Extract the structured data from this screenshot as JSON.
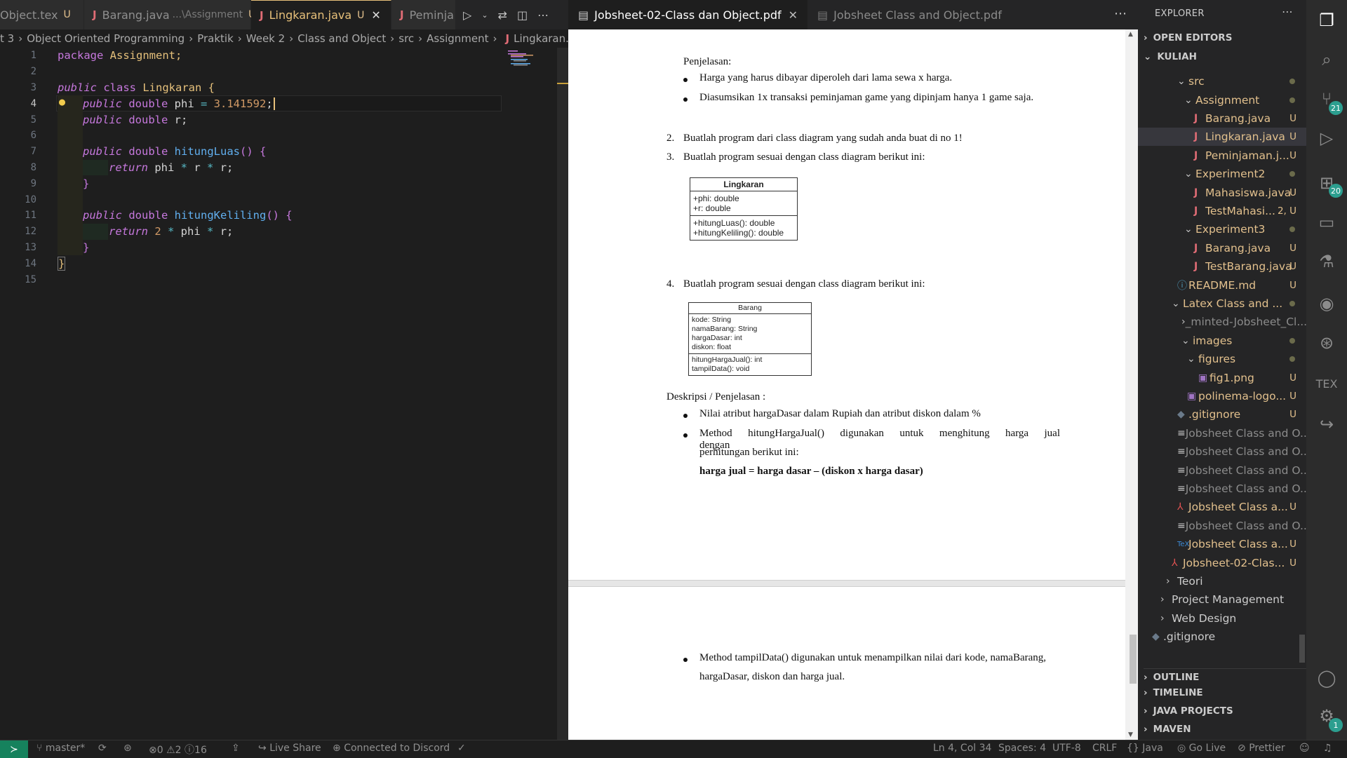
{
  "editor": {
    "tabs": [
      {
        "label": "Object.tex",
        "status": "U"
      },
      {
        "label": "Barang.java",
        "desc": "...\\Assignment",
        "status": "U"
      },
      {
        "label": "Lingkaran.java",
        "status": "U"
      },
      {
        "label": "Peminja"
      }
    ],
    "breadcrumb": [
      "t 3",
      "Object Oriented Programming",
      "Praktik",
      "Week 2",
      "Class and Object",
      "src",
      "Assignment",
      "Lingkaran.java"
    ],
    "line_numbers": [
      "1",
      "2",
      "3",
      "4",
      "5",
      "6",
      "7",
      "8",
      "9",
      "10",
      "11",
      "12",
      "13",
      "14",
      "15"
    ],
    "code": {
      "l1a": "package",
      "l1b": " Assignment;",
      "l3a": "public",
      "l3b": " class",
      "l3c": " Lingkaran",
      "l3d": " {",
      "l4a": "public",
      "l4b": " double",
      "l4c": " phi ",
      "l4d": "=",
      "l4e": " 3.141592",
      "l4f": ";",
      "l5a": "public",
      "l5b": " double",
      "l5c": " r;",
      "l7a": "public",
      "l7b": " double",
      "l7c": " hitungLuas",
      "l7d": "() {",
      "l8a": "return",
      "l8b": " phi ",
      "l8c": "*",
      "l8d": " r ",
      "l8e": "*",
      "l8f": " r;",
      "l9": "}",
      "l11a": "public",
      "l11b": " double",
      "l11c": " hitungKeliling",
      "l11d": "() {",
      "l12a": "return",
      "l12b": " 2",
      "l12c": " *",
      "l12d": " phi ",
      "l12e": "*",
      "l12f": " r;",
      "l13": "}",
      "l14": "}"
    }
  },
  "pdf": {
    "tabs": [
      {
        "label": "Jobsheet-02-Class dan Object.pdf"
      },
      {
        "label": "Jobsheet Class and Object.pdf"
      }
    ],
    "penjelasan": "Penjelasan:",
    "bullets1": [
      "Harga yang harus dibayar diperoleh dari lama sewa x harga.",
      "Diasumsikan 1x transaksi peminjaman game yang dipinjam hanya 1 game saja."
    ],
    "item2": {
      "num": "2.",
      "text": "Buatlah program dari class diagram yang sudah anda buat di no 1!"
    },
    "item3": {
      "num": "3.",
      "text": "Buatlah program sesuai dengan class diagram berikut ini:"
    },
    "uml1": {
      "name": "Lingkaran",
      "attrs": [
        "+phi: double",
        "+r: double"
      ],
      "methods": [
        "+hitungLuas(): double",
        "+hitungKeliling(): double"
      ]
    },
    "item4": {
      "num": "4.",
      "text": "Buatlah program sesuai dengan class diagram berikut ini:"
    },
    "uml2": {
      "name": "Barang",
      "attrs": [
        "kode: String",
        "namaBarang: String",
        "hargaDasar: int",
        "diskon: float"
      ],
      "methods": [
        "hitungHargaJual(): int",
        "tampilData(): void"
      ]
    },
    "deskripsi": "Deskripsi / Penjelasan :",
    "bullets2": [
      "Nilai atribut hargaDasar dalam Rupiah dan atribut diskon dalam %",
      "Method hitungHargaJual() digunakan untuk menghitung harga jual dengan",
      "perhitungan berikut ini:"
    ],
    "formula": "harga jual = harga dasar – (diskon x harga dasar)",
    "page2_bullet": [
      "Method tampilData() digunakan untuk menampilkan nilai dari kode, namaBarang,",
      "hargaDasar, diskon dan harga jual."
    ]
  },
  "sidebar": {
    "title": "EXPLORER",
    "open_editors": "OPEN EDITORS",
    "root": "KULIAH",
    "items": [
      {
        "label": "src",
        "type": "folder"
      },
      {
        "label": "Assignment",
        "type": "folder"
      },
      {
        "label": "Barang.java",
        "status": "U"
      },
      {
        "label": "Lingkaran.java",
        "status": "U"
      },
      {
        "label": "Peminjaman.j...",
        "status": "U"
      },
      {
        "label": "Experiment2",
        "type": "folder"
      },
      {
        "label": "Mahasiswa.java",
        "status": "U"
      },
      {
        "label": "TestMahasi...",
        "status": "2, U"
      },
      {
        "label": "Experiment3",
        "type": "folder"
      },
      {
        "label": "Barang.java",
        "status": "U"
      },
      {
        "label": "TestBarang.java",
        "status": "U"
      },
      {
        "label": "README.md",
        "status": "U"
      },
      {
        "label": "Latex Class and ...",
        "type": "folder"
      },
      {
        "label": "_minted-Jobsheet_Cl..."
      },
      {
        "label": "images",
        "type": "folder"
      },
      {
        "label": "figures",
        "type": "folder"
      },
      {
        "label": "fig1.png",
        "status": "U"
      },
      {
        "label": "polinema-logo...",
        "status": "U"
      },
      {
        "label": ".gitignore",
        "status": "U"
      },
      {
        "label": "Jobsheet Class and O..."
      },
      {
        "label": "Jobsheet Class and O..."
      },
      {
        "label": "Jobsheet Class and O..."
      },
      {
        "label": "Jobsheet Class and O..."
      },
      {
        "label": "Jobsheet Class a...",
        "status": "U"
      },
      {
        "label": "Jobsheet Class and O..."
      },
      {
        "label": "Jobsheet Class a...",
        "status": "U"
      },
      {
        "label": "Jobsheet-02-Clas...",
        "status": "U"
      },
      {
        "label": "Teori"
      },
      {
        "label": "Project Management"
      },
      {
        "label": "Web Design"
      },
      {
        "label": ".gitignore"
      }
    ],
    "sections": [
      "OUTLINE",
      "TIMELINE",
      "JAVA PROJECTS",
      "MAVEN"
    ]
  },
  "activity": {
    "scm_badge": "21",
    "ext_badge": "20",
    "settings_badge": "1",
    "tex_label": "TEX"
  },
  "status": {
    "branch": "master*",
    "errors": "0",
    "warnings": "2",
    "infos": "16",
    "live_share": "Live Share",
    "discord": "Connected to Discord",
    "position": "Ln 4, Col 34",
    "spaces": "Spaces: 4",
    "encoding": "UTF-8",
    "eol": "CRLF",
    "language": "Java",
    "golive": "Go Live",
    "prettier": "Prettier"
  }
}
